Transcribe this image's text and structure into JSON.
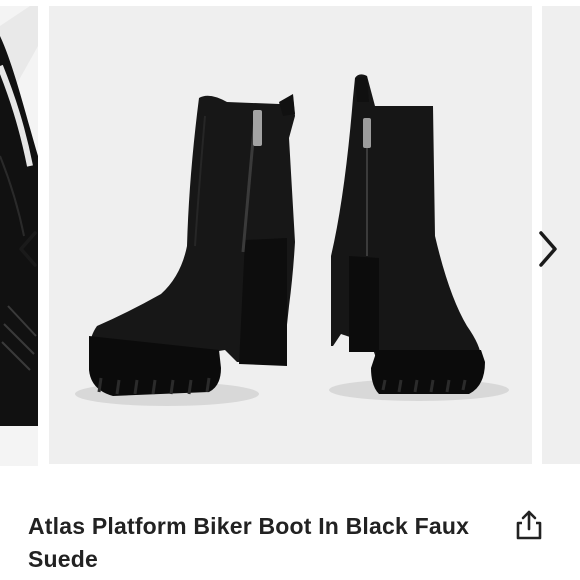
{
  "listing": {
    "title": "Atlas Platform Biker Boot In Black Faux Suede"
  },
  "carousel": {
    "prev_icon": "chevron-left-icon",
    "next_icon": "chevron-right-icon"
  },
  "actions": {
    "share_icon": "share-icon"
  },
  "colors": {
    "boot": "#121212",
    "photo_background": "#efefef",
    "title_text": "#222222"
  }
}
